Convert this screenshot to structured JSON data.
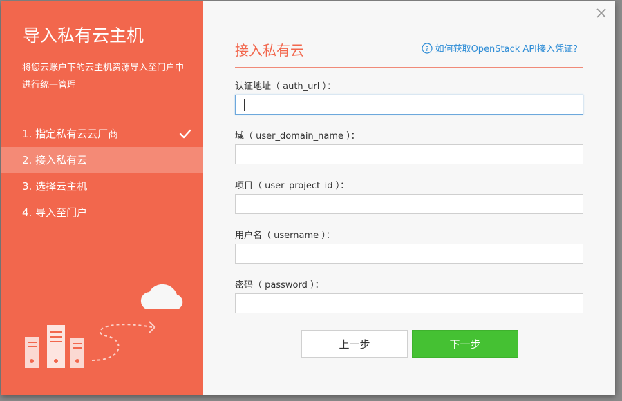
{
  "sidebar": {
    "title": "导入私有云主机",
    "description": "将您云账户下的云主机资源导入至门户中进行统一管理",
    "steps": [
      {
        "label": "1. 指定私有云云厂商",
        "done": true
      },
      {
        "label": "2. 接入私有云",
        "active": true
      },
      {
        "label": "3. 选择云主机"
      },
      {
        "label": "4. 导入至门户"
      }
    ]
  },
  "main": {
    "title": "接入私有云",
    "help_link": "如何获取OpenStack API接入凭证？",
    "fields": [
      {
        "label": "认证地址（ auth_url ）：",
        "value": ""
      },
      {
        "label": "域（ user_domain_name ）：",
        "value": ""
      },
      {
        "label": "项目（ user_project_id ）：",
        "value": ""
      },
      {
        "label": "用户名（ username ）：",
        "value": ""
      },
      {
        "label": "密码（ password ）：",
        "value": ""
      }
    ],
    "prev_label": "上一步",
    "next_label": "下一步"
  },
  "colors": {
    "accent": "#f2674d",
    "active_step": "#f48a76",
    "link": "#2f8dd6",
    "primary_button": "#45c133"
  },
  "icons": [
    "check-icon",
    "close-icon",
    "help-circle-icon",
    "cloud-icon",
    "server-icon"
  ]
}
